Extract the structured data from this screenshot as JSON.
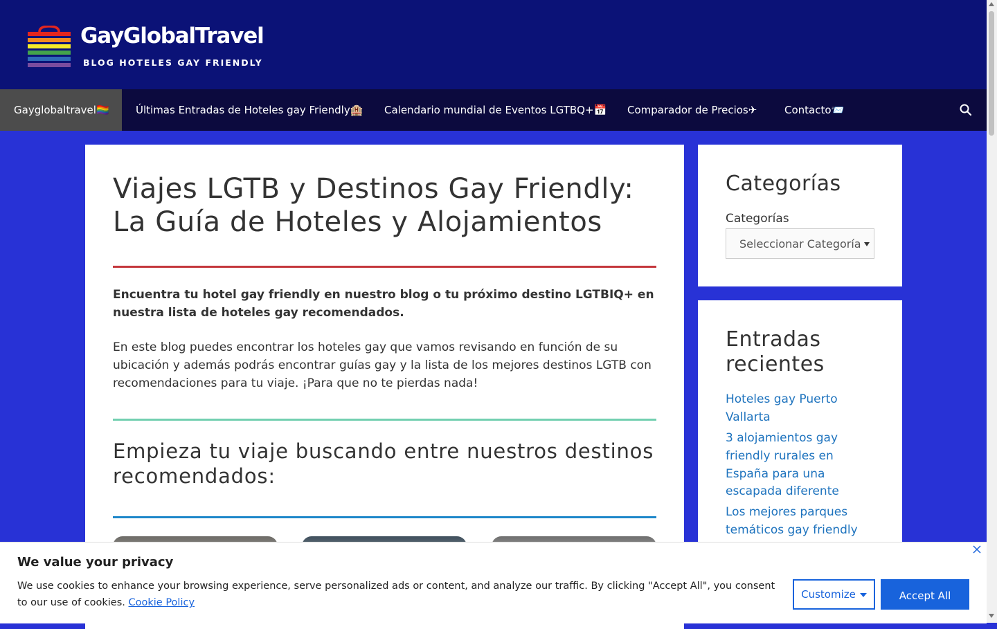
{
  "site": {
    "title": "GayGlobalTravel",
    "tagline": "BLOG HOTELES GAY FRIENDLY"
  },
  "nav": {
    "items": [
      "Gayglobaltravel🏳️‍🌈",
      "Últimas Entradas de Hoteles gay Friendly🏨",
      "Calendario mundial de Eventos LGTBQ+📅",
      "Comparador de Precios✈",
      "Contacto📨"
    ],
    "search_icon": "search-icon"
  },
  "main": {
    "title": "Viajes LGTB y Destinos Gay Friendly: La Guía de Hoteles y Alojamientos",
    "intro_bold": "Encuentra tu hotel gay friendly en nuestro blog o tu próximo destino LGTBIQ+ en nuestra lista de hoteles gay recomendados.",
    "intro": "En este blog puedes encontrar los hoteles gay que vamos revisando en función de su ubicación y además podrás encontrar guías gay y la lista de los mejores destinos LGTB con recomendaciones para tu viaje. ¡Para que no te pierdas nada!",
    "subheading": "Empieza tu viaje buscando entre nuestros destinos recomendados:",
    "separator_colors": [
      "#c4373c",
      "#72cfb0",
      "#1e87c9"
    ]
  },
  "sidebar": {
    "categories": {
      "title": "Categorías",
      "label": "Categorías",
      "select_value": "Seleccionar Categoría"
    },
    "recent": {
      "title": "Entradas recientes",
      "links": [
        "Hoteles gay Puerto Vallarta",
        "3 alojamientos gay friendly rurales en España para una escapada diferente",
        "Los mejores parques temáticos gay friendly"
      ]
    }
  },
  "cookie": {
    "title": "We value your privacy",
    "text": "We use cookies to enhance your browsing experience, serve personalized ads or content, and analyze our traffic. By clicking \"Accept All\", you consent to our use of cookies.",
    "link": "Cookie Policy",
    "customize": "Customize",
    "accept": "Accept All"
  },
  "colors": {
    "header_bg": "#0b1277",
    "nav_bg": "#0c0a3e",
    "page_bg": "#2832d6",
    "link": "#1e73be",
    "button": "#1863dc"
  }
}
